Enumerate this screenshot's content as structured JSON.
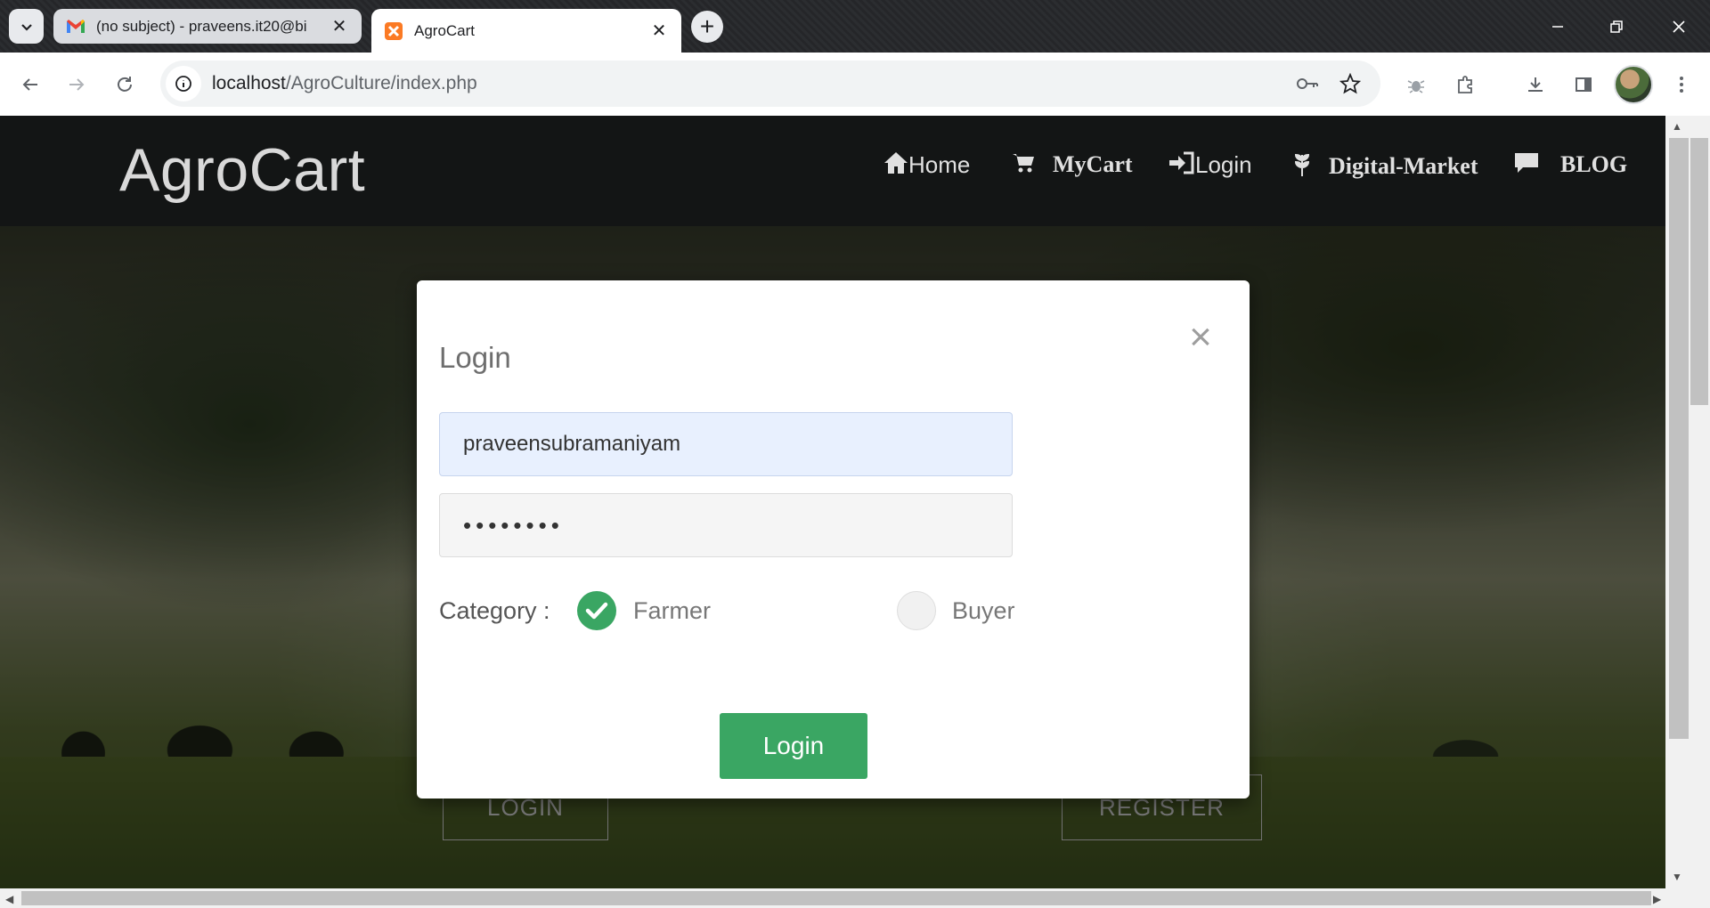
{
  "browser": {
    "tabs": [
      {
        "title": "(no subject) - praveens.it20@bi",
        "favicon": "gmail-icon",
        "active": false
      },
      {
        "title": "AgroCart",
        "favicon": "xampp-icon",
        "active": true
      }
    ],
    "url_host": "localhost",
    "url_path": "/AgroCulture/index.php"
  },
  "site": {
    "brand": "AgroCart",
    "menu": [
      {
        "label": "Home",
        "icon": "home-icon"
      },
      {
        "label": "MyCart",
        "icon": "cart-icon"
      },
      {
        "label": "Login",
        "icon": "login-icon"
      },
      {
        "label": "Digital-Market",
        "icon": "leaf-icon"
      },
      {
        "label": "BLOG",
        "icon": "comment-icon"
      }
    ],
    "hero_buttons": {
      "login": "LOGIN",
      "register": "REGISTER"
    }
  },
  "modal": {
    "title": "Login",
    "username_value": "praveensubramaniyam",
    "password_value": "••••••••",
    "category_label": "Category :",
    "options": [
      {
        "label": "Farmer",
        "checked": true
      },
      {
        "label": "Buyer",
        "checked": false
      }
    ],
    "submit_label": "Login"
  },
  "colors": {
    "accent_green": "#3aa663",
    "header_bg": "#131515"
  }
}
